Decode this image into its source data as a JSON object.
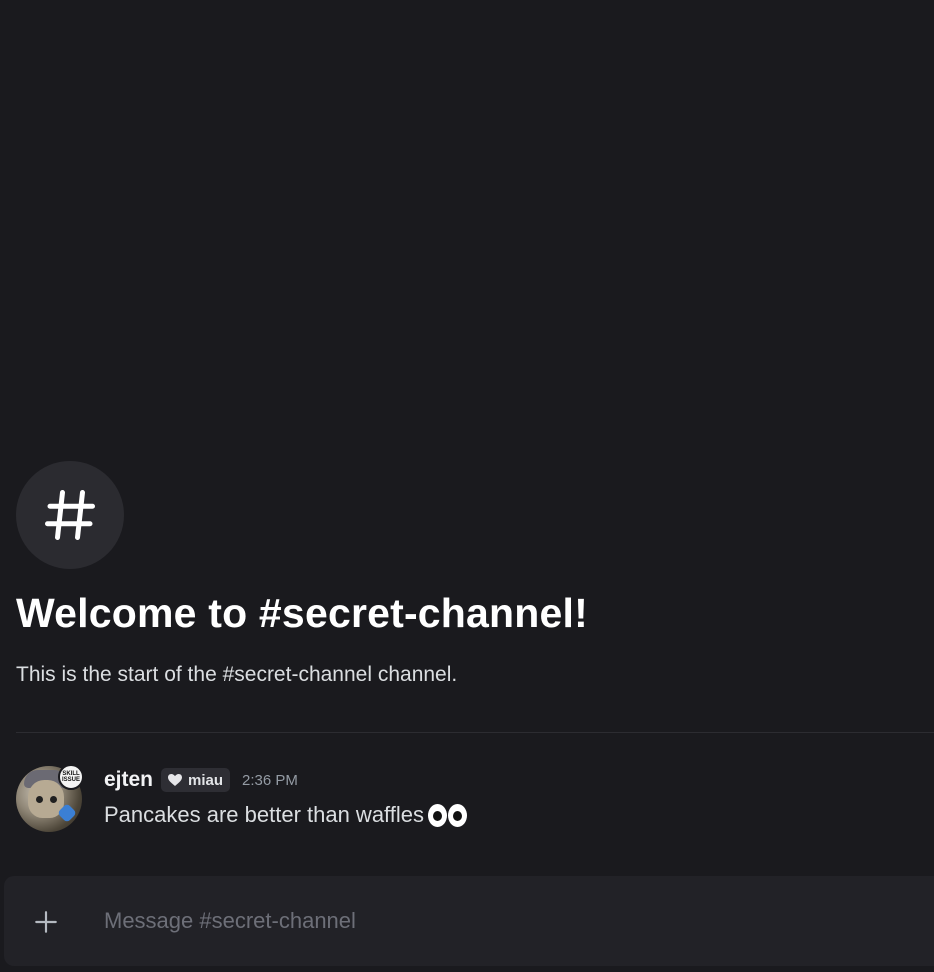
{
  "welcome": {
    "icon": "hash-icon",
    "title": "Welcome to #secret-channel!",
    "subtitle": "This is the start of the #secret-channel channel."
  },
  "message": {
    "username": "ejten",
    "avatar_badge": "SKILL ISSUE",
    "tag_icon": "heart-icon",
    "tag_label": "miau",
    "timestamp": "2:36 PM",
    "text": "Pancakes are better than waffles",
    "emoji": "eyes-emoji"
  },
  "composer": {
    "add_icon": "plus-icon",
    "placeholder": "Message #secret-channel"
  },
  "colors": {
    "background": "#1a1a1e",
    "composer": "#222227",
    "text_primary": "#f2f3f5",
    "text_muted": "#949ba4"
  }
}
